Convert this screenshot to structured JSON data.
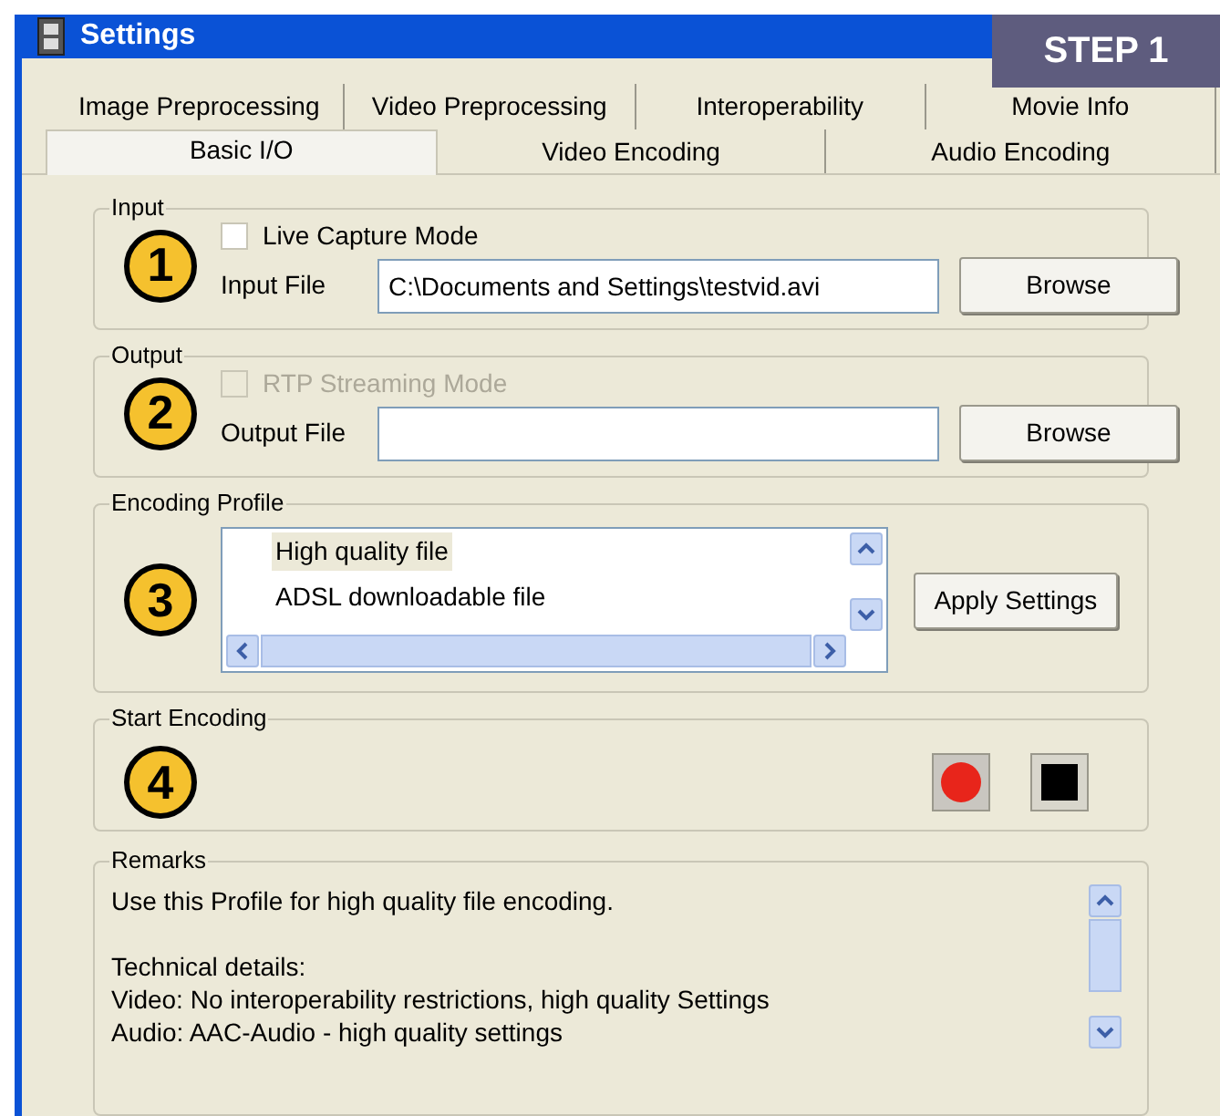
{
  "window": {
    "title": "Settings"
  },
  "step_badge": "STEP 1",
  "tabs": [
    [
      {
        "label": "Image Preprocessing",
        "selected": false
      },
      {
        "label": "Video Preprocessing",
        "selected": false
      },
      {
        "label": "Interoperability",
        "selected": false
      },
      {
        "label": "Movie Info",
        "selected": false
      }
    ],
    [
      {
        "label": "Basic I/O",
        "selected": true
      },
      {
        "label": "Video Encoding",
        "selected": false
      },
      {
        "label": "Audio Encoding",
        "selected": false
      }
    ]
  ],
  "input": {
    "title": "Input",
    "step": "1",
    "checkbox": {
      "label": "Live Capture Mode",
      "checked": false,
      "disabled": false
    },
    "field_label": "Input File",
    "value": "C:\\Documents and Settings\\testvid.avi",
    "button": "Browse"
  },
  "output": {
    "title": "Output",
    "step": "2",
    "checkbox": {
      "label": "RTP Streaming Mode",
      "checked": false,
      "disabled": true
    },
    "field_label": "Output File",
    "button": "Browse"
  },
  "encoding_profile": {
    "title": "Encoding Profile",
    "step": "3",
    "items": [
      {
        "label": "High quality file",
        "selected": true
      },
      {
        "label": "ADSL downloadable file",
        "selected": false
      }
    ],
    "button": "Apply Settings"
  },
  "start_encoding": {
    "title": "Start Encoding",
    "step": "4"
  },
  "remarks": {
    "title": "Remarks",
    "paragraphs": [
      [
        "Use this Profile for high quality file encoding."
      ],
      [
        "Technical details:",
        "Video: No interoperability restrictions, high quality Settings",
        "Audio: AAC-Audio - high quality settings"
      ]
    ]
  }
}
